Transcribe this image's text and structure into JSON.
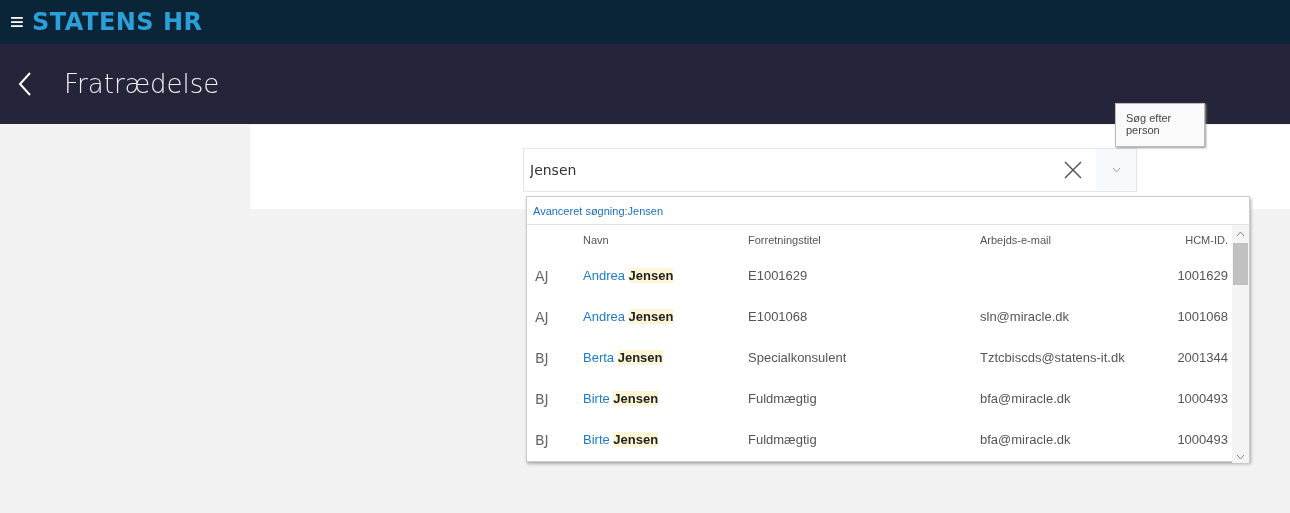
{
  "header": {
    "menu_icon": "≡",
    "brand": "STATENS HR"
  },
  "page": {
    "title": "Fratrædelse"
  },
  "search": {
    "value": "Jensen",
    "tooltip": "Søg efter person"
  },
  "results": {
    "advanced_link": "Avanceret søgning:Jensen",
    "columns": [
      "Navn",
      "Forretningstitel",
      "Arbejds-e-mail",
      "HCM-ID."
    ],
    "rows": [
      {
        "initials": "AJ",
        "name": "Andrea **Jensen**",
        "title": "E1001629",
        "email": "",
        "id": "1001629"
      },
      {
        "initials": "AJ",
        "name": "Andrea **Jensen**",
        "title": "E1001068",
        "email": "sln@miracle.dk",
        "id": "1001068"
      },
      {
        "initials": "BJ",
        "name": "Berta **Jensen**",
        "title": "Specialkonsulent",
        "email": "Tztcbiscds@statens-it.dk",
        "id": "2001344"
      },
      {
        "initials": "BJ",
        "name": "Birte **Jensen**",
        "title": "Fuldmægtig",
        "email": "bfa@miracle.dk",
        "id": "1000493"
      },
      {
        "initials": "BJ",
        "name": "Birte **Jensen**",
        "title": "Fuldmægtig",
        "email": "bfa@miracle.dk",
        "id": "1000493"
      }
    ]
  }
}
